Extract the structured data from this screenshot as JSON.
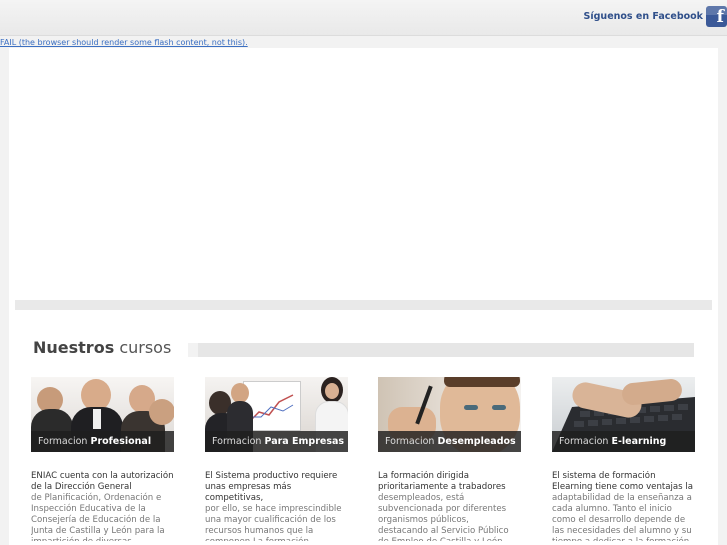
{
  "header": {
    "facebook_label": "Síguenos en Facebook",
    "facebook_icon": "facebook-icon",
    "facebook_glyph": "f"
  },
  "flash": {
    "fallback_text": "FAIL (the browser should render some flash content, not this)."
  },
  "section": {
    "title_bold": "Nuestros",
    "title_rest": "cursos"
  },
  "courses": [
    {
      "caption_prefix": "Formacion",
      "caption_bold": "Profesional",
      "lead": "ENIAC cuenta con la autorización de la Dirección General",
      "body": "de Planificación, Ordenación e Inspección Educativa de la Consejería de Educación de la Junta de Castilla y León para la impartición de diversas"
    },
    {
      "caption_prefix": "Formacion",
      "caption_bold": "Para Empresas",
      "lead": "El Sistema productivo requiere unas empresas más competitivas,",
      "body": "por ello, se hace imprescindible una mayor cualificación de los recursos humanos que la componen.La formación"
    },
    {
      "caption_prefix": "Formacion",
      "caption_bold": "Desempleados",
      "lead": "La formación dirigida prioritariamente a trabadores",
      "body": "desempleados, está subvencionada por diferentes organismos públicos, destacando al Servicio Público de Empleo de Castilla y León, con el"
    },
    {
      "caption_prefix": "Formacion",
      "caption_bold": "E-learning",
      "lead": "El sistema de formación Elearning tiene como ventajas la",
      "body": "adaptabilidad de la enseñanza a cada alumno. Tanto el inicio como el desarrollo depende de las necesidades del alumno y su tiempo a dedicar a la formación"
    }
  ],
  "colors": {
    "facebook_blue": "#3b5998",
    "link_blue": "#3b6fc2",
    "caption_bar": "#1e1e1e"
  }
}
